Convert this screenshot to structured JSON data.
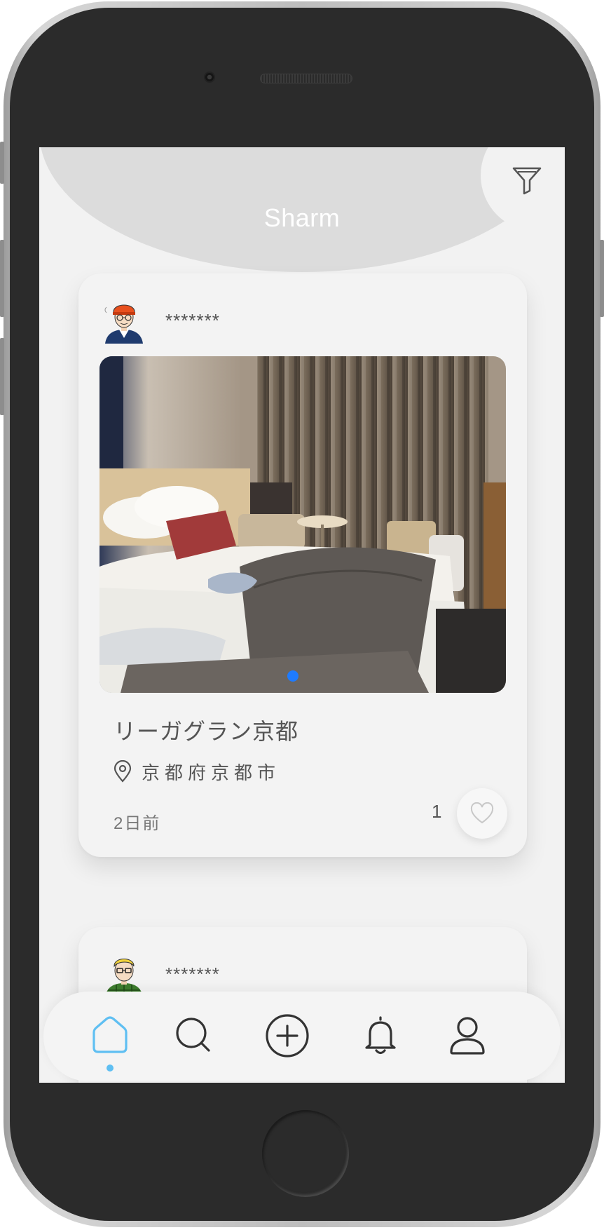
{
  "app": {
    "title": "Sharm"
  },
  "header": {
    "filter_icon": "filter-icon"
  },
  "posts": [
    {
      "username": "*******",
      "place_name": "リーガグラン京都",
      "location": "京都府京都市",
      "time_ago": "2日前",
      "like_count": "1",
      "photo_count": 1,
      "active_photo": 1
    },
    {
      "username": "*******"
    }
  ],
  "tabbar": {
    "items": [
      {
        "icon": "home-icon",
        "active": true
      },
      {
        "icon": "search-icon",
        "active": false
      },
      {
        "icon": "add-circle-icon",
        "active": false
      },
      {
        "icon": "bell-icon",
        "active": false
      },
      {
        "icon": "user-icon",
        "active": false
      }
    ],
    "active_color": "#5fbff2",
    "inactive_color": "#333333"
  },
  "colors": {
    "screen_bg": "#f2f2f2",
    "header_blob": "#dcdcdc",
    "carousel_dot": "#1e7bff"
  }
}
